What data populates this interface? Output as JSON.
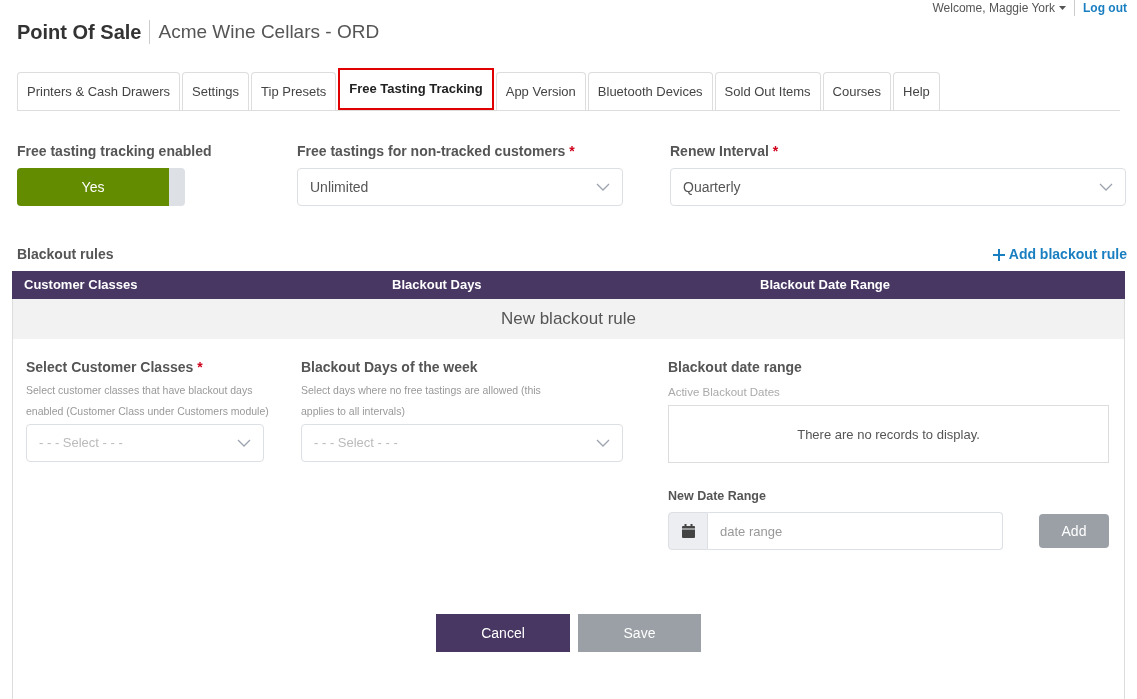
{
  "header": {
    "welcome": "Welcome, Maggie York",
    "logout": "Log out",
    "title": "Point Of Sale",
    "subtitle": "Acme Wine Cellars - ORD"
  },
  "tabs": [
    {
      "label": "Printers & Cash Drawers",
      "selected": false
    },
    {
      "label": "Settings",
      "selected": false
    },
    {
      "label": "Tip Presets",
      "selected": false
    },
    {
      "label": "Free Tasting Tracking",
      "selected": true
    },
    {
      "label": "App Version",
      "selected": false
    },
    {
      "label": "Bluetooth Devices",
      "selected": false
    },
    {
      "label": "Sold Out Items",
      "selected": false
    },
    {
      "label": "Courses",
      "selected": false
    },
    {
      "label": "Help",
      "selected": false
    }
  ],
  "settings": {
    "tracking": {
      "label": "Free tasting tracking enabled",
      "on": true,
      "value": "Yes"
    },
    "non_tracked": {
      "label": "Free tastings for non-tracked customers",
      "required_mark": "*",
      "value": "Unlimited"
    },
    "renew": {
      "label": "Renew Interval",
      "required_mark": "*",
      "value": "Quarterly"
    }
  },
  "blackout": {
    "title": "Blackout rules",
    "add_link": "Add blackout rule",
    "columns": [
      "Customer Classes",
      "Blackout Days",
      "Blackout Date Range"
    ],
    "new_rule": {
      "title": "New blackout rule",
      "classes": {
        "label": "Select Customer Classes",
        "required_mark": "*",
        "help": "Select customer classes that have blackout days enabled (Customer Class under Customers module)",
        "placeholder": "- - - Select - - -"
      },
      "days": {
        "label": "Blackout Days of the week",
        "help": "Select days where no free tastings are allowed (this applies to all intervals)",
        "placeholder": "- - - Select - - -"
      },
      "range": {
        "label": "Blackout date range",
        "sub": "Active Blackout Dates",
        "empty": "There are no records to display.",
        "new_label": "New Date Range",
        "placeholder": "date range",
        "add": {
          "label": "Add",
          "disabled": true
        }
      },
      "buttons": [
        {
          "label": "Cancel",
          "disabled": false,
          "kind": "primary"
        },
        {
          "label": "Save",
          "disabled": true,
          "kind": "primary"
        }
      ]
    }
  }
}
